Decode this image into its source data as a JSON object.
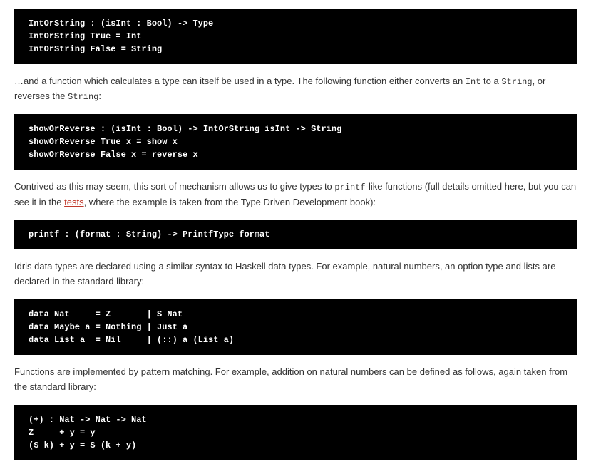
{
  "code1": "IntOrString : (isInt : Bool) -> Type\nIntOrString True = Int\nIntOrString False = String",
  "para1_a": "…and a function which calculates a type can itself be used in a type. The following function either converts an ",
  "para1_code1": "Int",
  "para1_b": " to a ",
  "para1_code2": "String",
  "para1_c": ", or reverses the ",
  "para1_code3": "String",
  "para1_d": ":",
  "code2": "showOrReverse : (isInt : Bool) -> IntOrString isInt -> String\nshowOrReverse True x = show x\nshowOrReverse False x = reverse x",
  "para2_a": "Contrived as this may seem, this sort of mechanism allows us to give types to ",
  "para2_code1": "printf",
  "para2_b": "-like functions (full details omitted here, but you can see it in the ",
  "para2_link": "tests",
  "para2_c": ", where the example is taken from the Type Driven Development book):",
  "code3": "printf : (format : String) -> PrintfType format",
  "para3": "Idris data types are declared using a similar syntax to Haskell data types. For example, natural numbers, an option type and lists are declared in the standard library:",
  "code4": "data Nat     = Z       | S Nat\ndata Maybe a = Nothing | Just a\ndata List a  = Nil     | (::) a (List a)",
  "para4": "Functions are implemented by pattern matching. For example, addition on natural numbers can be defined as follows, again taken from the standard library:",
  "code5": "(+) : Nat -> Nat -> Nat\nZ     + y = y\n(S k) + y = S (k + y)"
}
